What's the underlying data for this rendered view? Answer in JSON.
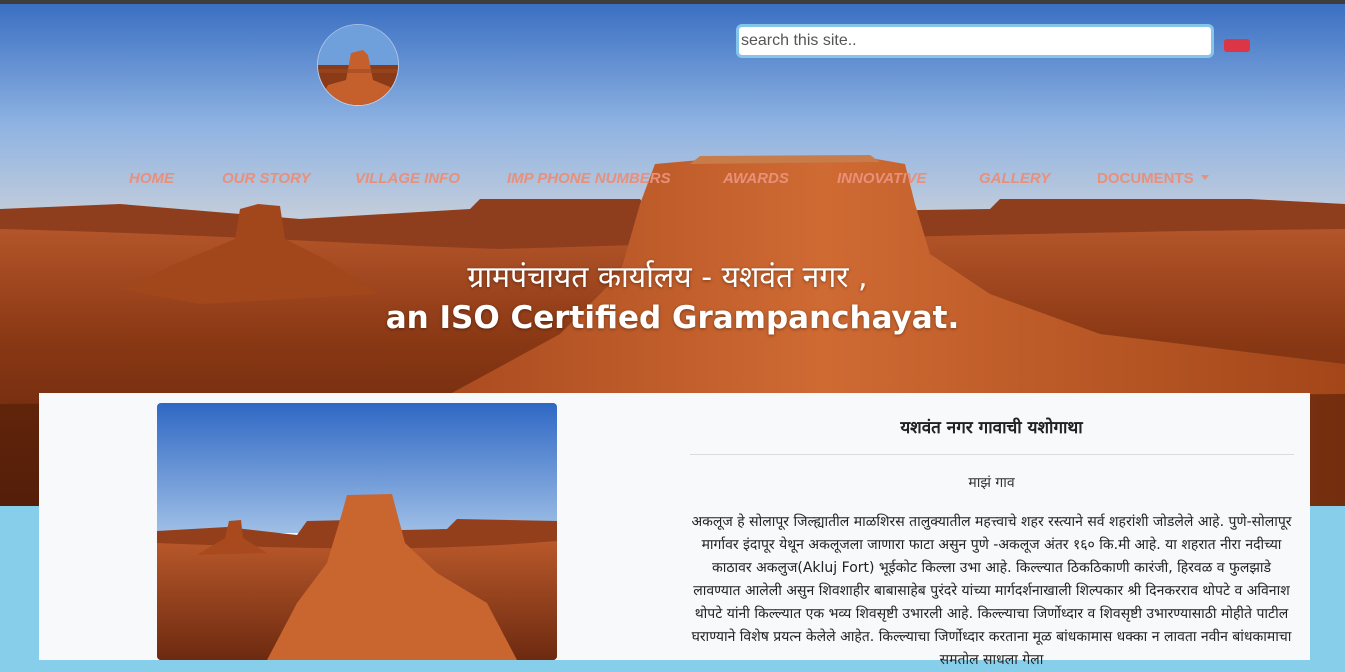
{
  "search": {
    "placeholder": "search this site.."
  },
  "nav": {
    "items": [
      "HOME",
      "OUR STORY",
      "VILLAGE INFO",
      "IMP PHONE NUMBERS",
      "AWARDS",
      "INNOVATIVE",
      "GALLERY"
    ],
    "dropdown_label": "DOCUMENTS"
  },
  "hero": {
    "line1": "ग्रामपंचायत कार्यालय - यशवंत नगर ,",
    "line2": "an ISO Certified Grampanchayat."
  },
  "story": {
    "title": "यशवंत नगर गावाची यशोगाथा",
    "subtitle": "माझं गाव",
    "body": "अकलूज हे सोलापूर जिल्ह्यातील माळशिरस तालुक्यातील महत्त्वाचे शहर रस्त्याने सर्व शहरांशी जोडलेले आहे. पुणे-सोलापूर मार्गावर इंदापूर येथून अकलूजला जाणारा फाटा असुन पुणे -अकलूज अंतर १६० कि.मी आहे. या शहरात नीरा नदीच्या काठावर अकलुज(Akluj Fort) भूईकोट किल्ला उभा आहे. किल्ल्यात ठिकठिकाणी कारंजी, हिरवळ व फुलझाडे लावण्यात आलेली असुन शिवशाहीर बाबासाहेब पुरंदरे यांच्या मार्गदर्शनाखाली शिल्पकार श्री दिनकरराव थोपटे व अविनाश थोपटे यांनी किल्ल्यात एक भव्य शिवसृष्टी उभारली आहे. किल्ल्याचा जिर्णोध्दार व शिवसृष्टी उभारण्यासाठी मोहीते पाटील घराण्याने विशेष प्रयत्न केलेले आहेत. किल्ल्याचा जिर्णोध्दार करताना मूळ बांधकामास धक्का न लावता नवीन बांधकामाचा समतोल साधला गेला"
  },
  "colors": {
    "nav_text": "#e8907a",
    "search_border": "#86c5ea",
    "search_button": "#dc3545",
    "page_background": "#87CEEB",
    "content_background": "#f8f9fa"
  }
}
